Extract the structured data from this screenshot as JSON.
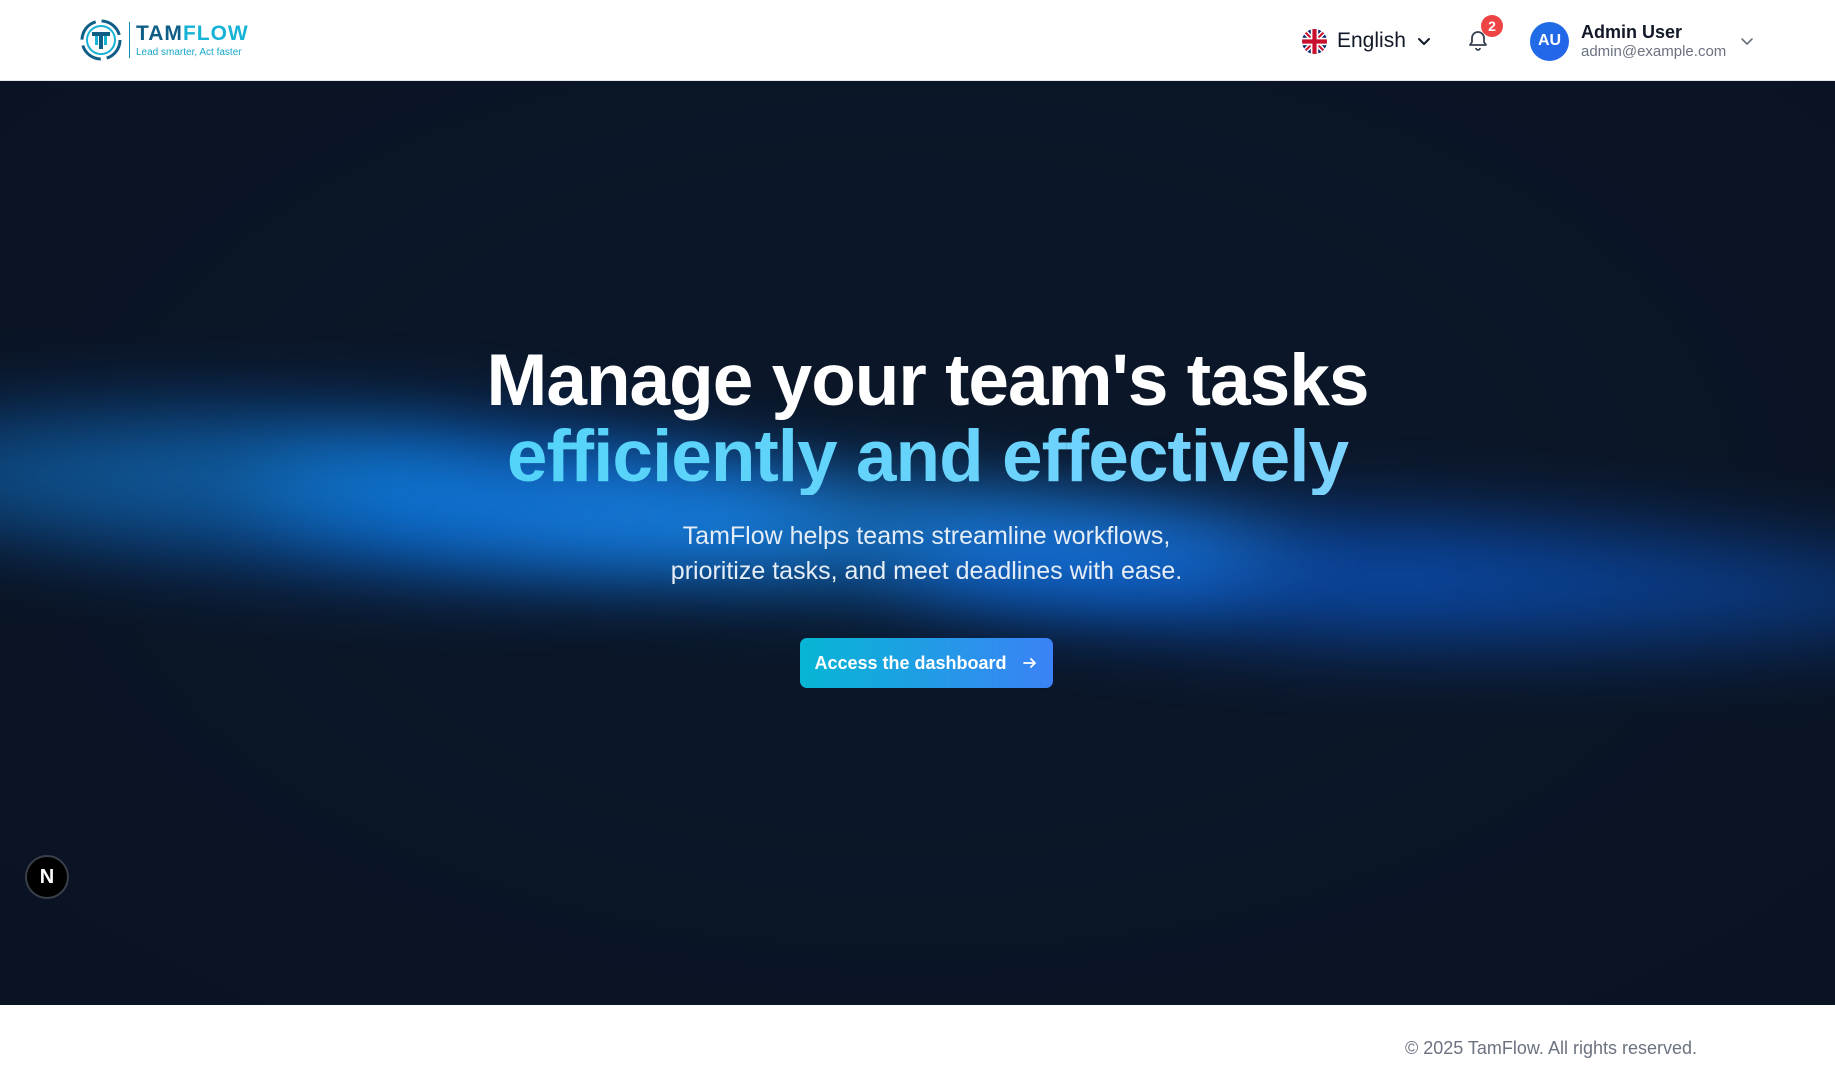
{
  "header": {
    "logo": {
      "name_part1": "TAM",
      "name_part2": "FLOW",
      "tagline": "Lead smarter, Act faster",
      "colors": {
        "primary": "#0f5e86",
        "accent": "#17b3d6"
      }
    },
    "language": {
      "label": "English",
      "icon": "uk-flag-icon"
    },
    "notifications": {
      "icon": "bell-icon",
      "count": "2"
    },
    "user": {
      "initials": "AU",
      "name": "Admin User",
      "email": "admin@example.com"
    }
  },
  "hero": {
    "title_line1": "Manage your team's tasks",
    "title_line2": "efficiently and effectively",
    "subtitle_line1": "TamFlow helps teams streamline workflows,",
    "subtitle_line2": "prioritize tasks, and meet deadlines with ease.",
    "cta_label": "Access the dashboard",
    "cta_icon": "arrow-right-icon"
  },
  "dev_badge": {
    "label": "N"
  },
  "footer": {
    "copyright": "© 2025 TamFlow. All rights reserved."
  },
  "colors": {
    "hero_bg": "#0b1628",
    "cta_start": "#06b6d4",
    "cta_end": "#3b82f6",
    "badge": "#ef4444"
  }
}
